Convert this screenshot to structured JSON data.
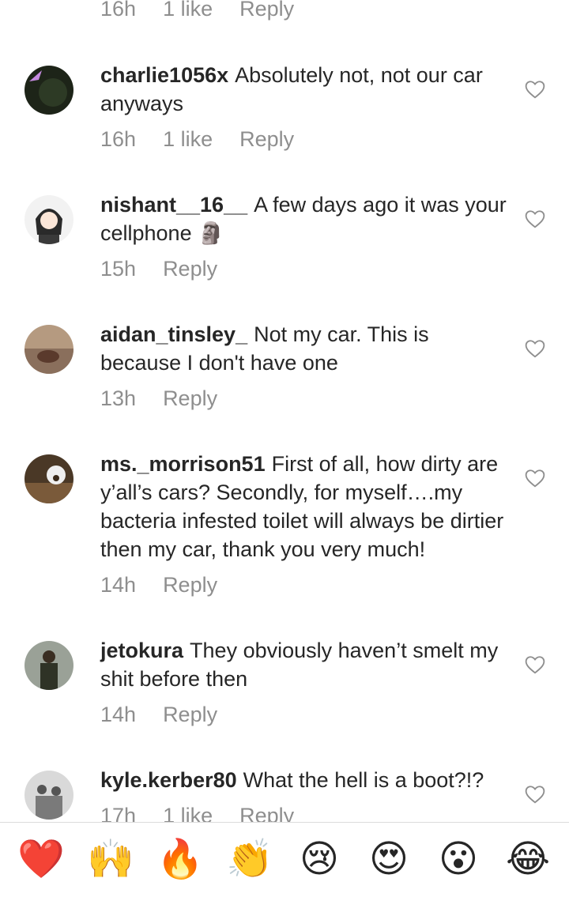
{
  "top_partial": {
    "time": "16h",
    "likes": "1 like",
    "reply": "Reply"
  },
  "comments": [
    {
      "username": "charlie1056x",
      "text": "Absolutely not, not our car anyways",
      "time": "16h",
      "likes": "1 like",
      "reply": "Reply"
    },
    {
      "username": "nishant__16__",
      "text": "A few days ago it was your cellphone 🗿",
      "time": "15h",
      "likes": "",
      "reply": "Reply"
    },
    {
      "username": "aidan_tinsley_",
      "text": "Not my car. This is because I don't have one",
      "time": "13h",
      "likes": "",
      "reply": "Reply"
    },
    {
      "username": "ms._morrison51",
      "text": "First of all, how dirty are y’all’s cars? Secondly, for myself….my bacteria infested toilet will always be dirtier then my car, thank you very much!",
      "time": "14h",
      "likes": "",
      "reply": "Reply"
    },
    {
      "username": "jetokura",
      "text": "They obviously haven’t smelt my shit before then",
      "time": "14h",
      "likes": "",
      "reply": "Reply"
    },
    {
      "username": "kyle.kerber80",
      "text": "What the hell is a boot?!?",
      "time": "17h",
      "likes": "1 like",
      "reply": "Reply"
    }
  ],
  "emoji_bar": [
    "❤️",
    "🙌",
    "🔥",
    "👏",
    "😢",
    "😍",
    "😮",
    "😂"
  ],
  "icons": {
    "like": "heart-outline-icon"
  },
  "colors": {
    "text": "#262626",
    "meta": "#8e8e8e",
    "divider": "#dbdbdb"
  }
}
